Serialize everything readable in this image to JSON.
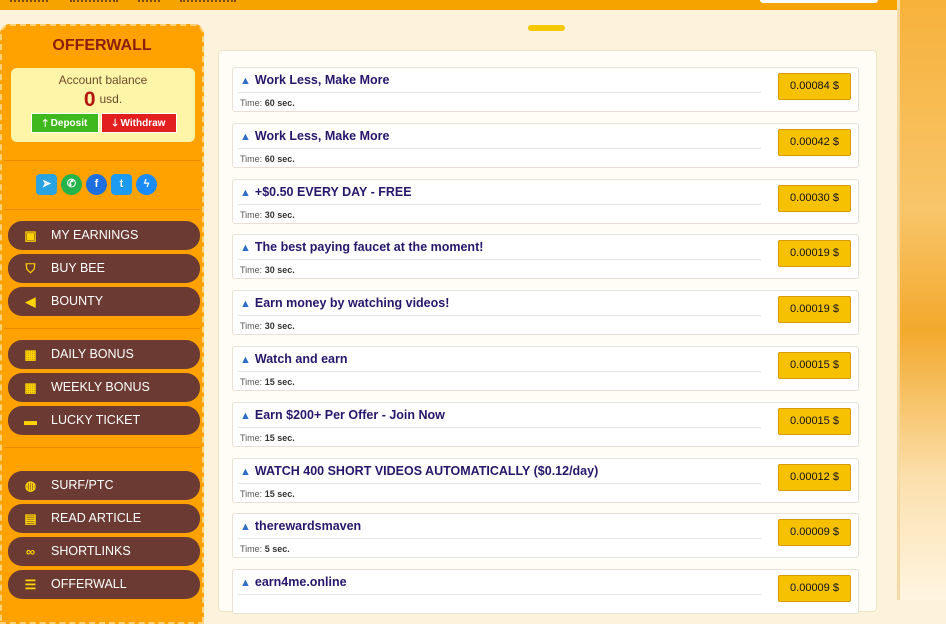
{
  "sidebar": {
    "title": "OFFERWALL",
    "balance_label": "Account balance",
    "balance_amount": "0",
    "balance_unit": "usd.",
    "deposit_label": "Deposit",
    "withdraw_label": "Withdraw",
    "socials": [
      {
        "name": "telegram-icon",
        "color": "#2aa3e0"
      },
      {
        "name": "whatsapp-icon",
        "color": "#25b34b"
      },
      {
        "name": "facebook-icon",
        "color": "#1d6fe0"
      },
      {
        "name": "twitter-icon",
        "color": "#1d9bf0"
      },
      {
        "name": "messenger-icon",
        "color": "#1a8cff"
      }
    ],
    "menu": [
      {
        "label": "MY EARNINGS",
        "icon": "money-icon"
      },
      {
        "label": "BUY BEE",
        "icon": "basket-icon"
      },
      {
        "label": "BOUNTY",
        "icon": "megaphone-icon"
      },
      {
        "label": "DAILY BONUS",
        "icon": "gift-icon"
      },
      {
        "label": "WEEKLY BONUS",
        "icon": "gift-icon"
      },
      {
        "label": "LUCKY TICKET",
        "icon": "ticket-icon"
      },
      {
        "label": "SURF/PTC",
        "icon": "globe-icon"
      },
      {
        "label": "READ ARTICLE",
        "icon": "article-icon"
      },
      {
        "label": "SHORTLINKS",
        "icon": "link-icon"
      },
      {
        "label": "OFFERWALL",
        "icon": "coins-icon"
      }
    ]
  },
  "offers_time_label": "Time:",
  "offers": [
    {
      "title": "Work Less, Make More",
      "time": "60 sec.",
      "price": "0.00084 $"
    },
    {
      "title": "Work Less, Make More",
      "time": "60 sec.",
      "price": "0.00042 $"
    },
    {
      "title": "+$0.50 EVERY DAY - FREE",
      "time": "30 sec.",
      "price": "0.00030 $"
    },
    {
      "title": "The best paying faucet at the moment!",
      "time": "30 sec.",
      "price": "0.00019 $"
    },
    {
      "title": "Earn money by watching videos!",
      "time": "30 sec.",
      "price": "0.00019 $"
    },
    {
      "title": "Watch and earn",
      "time": "15 sec.",
      "price": "0.00015 $"
    },
    {
      "title": "Earn $200+ Per Offer - Join Now",
      "time": "15 sec.",
      "price": "0.00015 $"
    },
    {
      "title": "WATCH 400 SHORT VIDEOS AUTOMATICALLY ($0.12/day)",
      "time": "15 sec.",
      "price": "0.00012 $"
    },
    {
      "title": "therewardsmaven",
      "time": "5 sec.",
      "price": "0.00009 $"
    },
    {
      "title": "earn4me.online",
      "time": "",
      "price": "0.00009 $"
    }
  ]
}
